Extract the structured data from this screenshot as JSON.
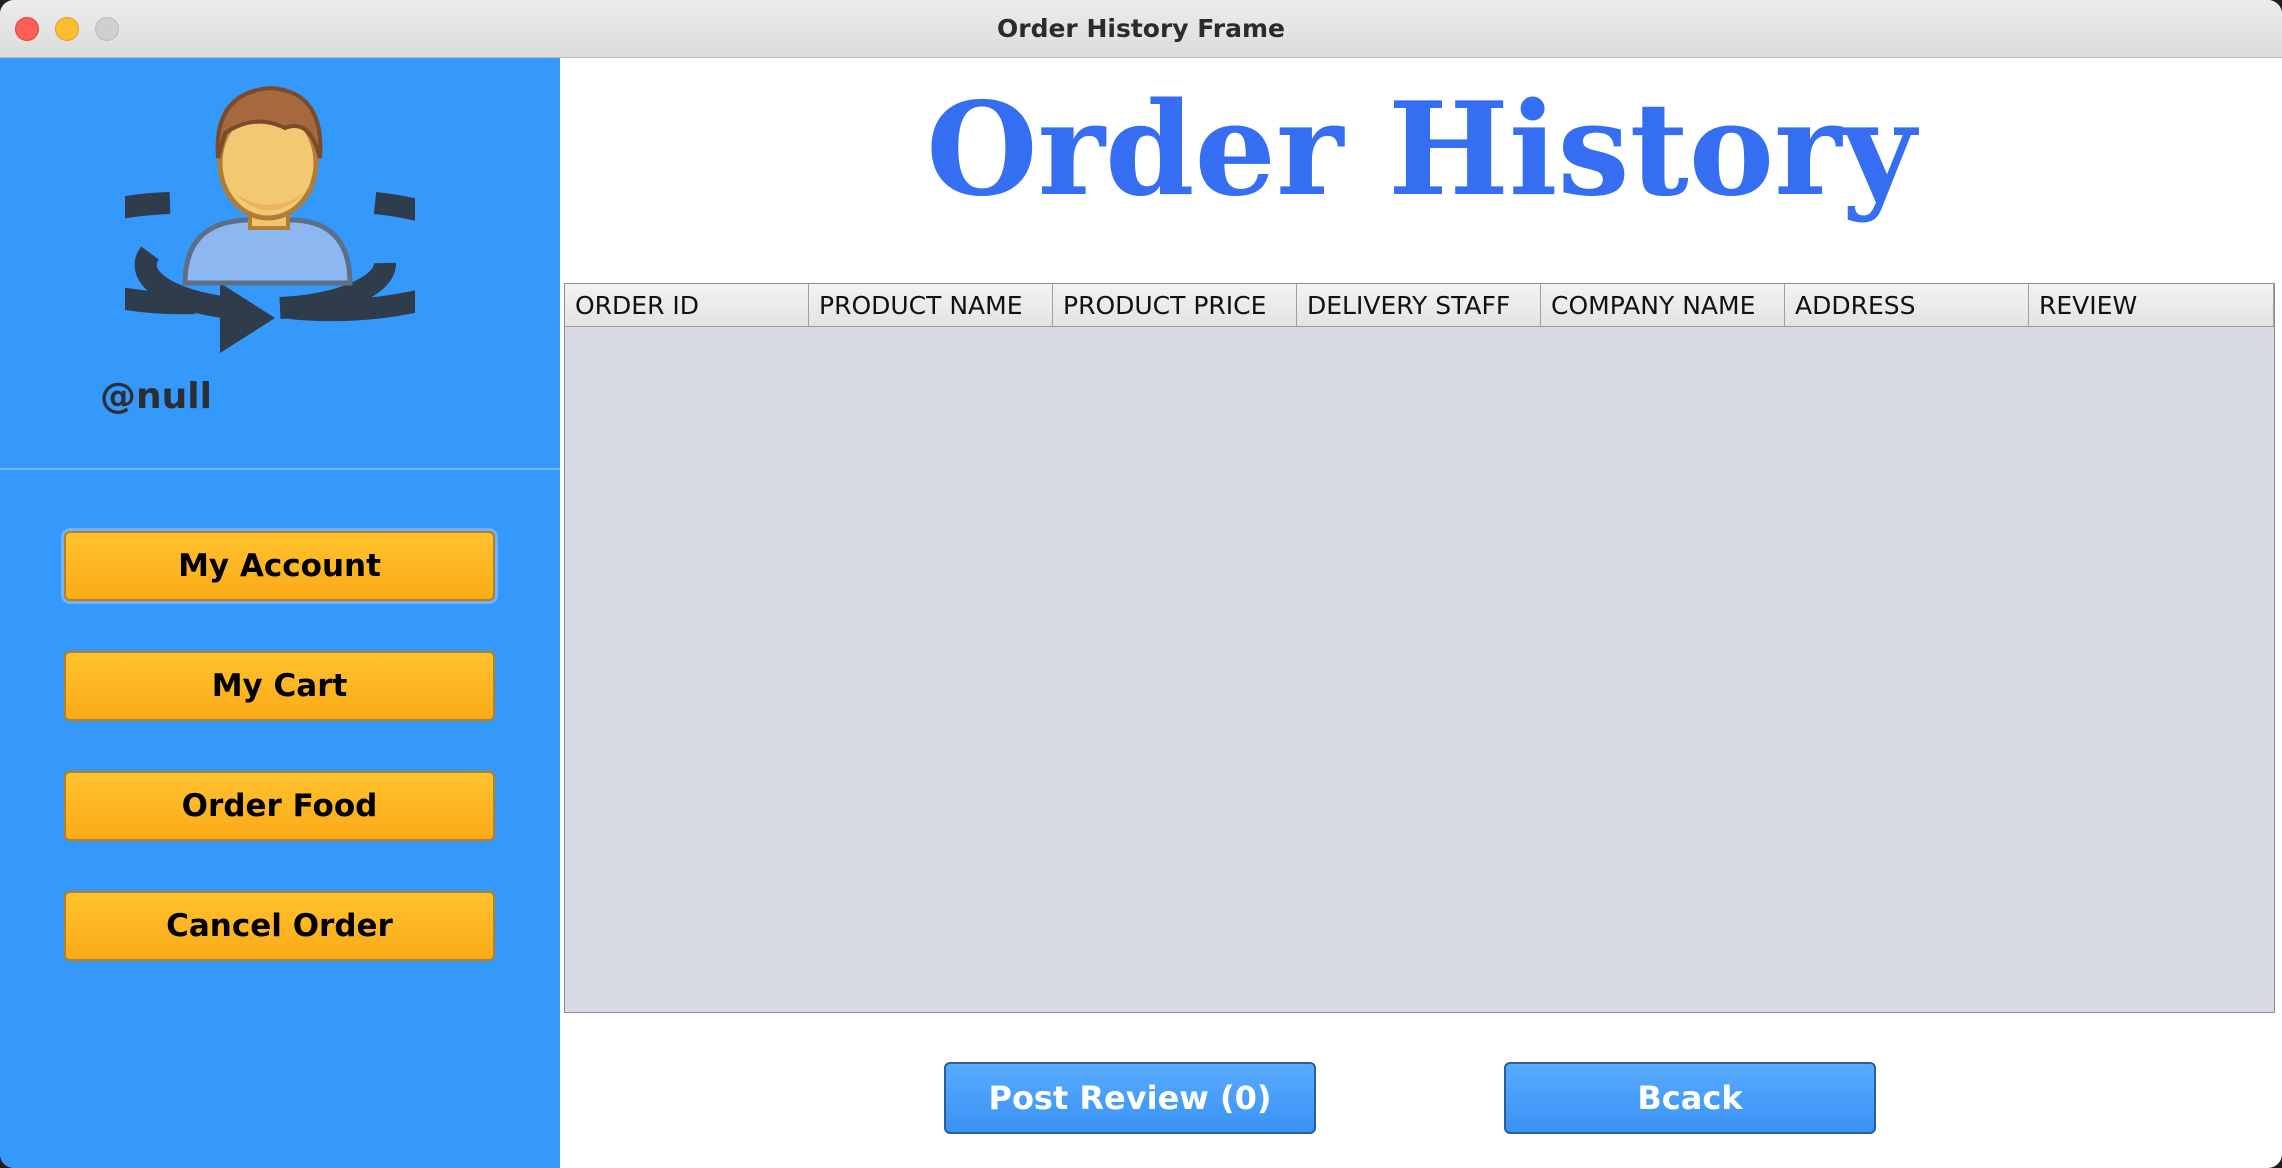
{
  "window": {
    "title": "Order History Frame"
  },
  "sidebar": {
    "username": "@null",
    "buttons": [
      {
        "label": "My Account"
      },
      {
        "label": "My Cart"
      },
      {
        "label": "Order Food"
      },
      {
        "label": "Cancel Order"
      }
    ]
  },
  "main": {
    "heading": "Order History",
    "table": {
      "columns": [
        "ORDER ID",
        "PRODUCT NAME",
        "PRODUCT PRICE",
        "DELIVERY STAFF",
        "COMPANY NAME",
        "ADDRESS",
        "REVIEW"
      ],
      "rows": []
    },
    "post_review_label": "Post Review (0)",
    "back_label": "Bcack"
  },
  "colors": {
    "sidebar": "#3598fb",
    "heading": "#356ef3",
    "sidebar_button": "#fbab18",
    "action_button": "#3b92f3",
    "table_body": "#d7dae2"
  },
  "icons": {
    "avatar": "user-switch-icon"
  }
}
